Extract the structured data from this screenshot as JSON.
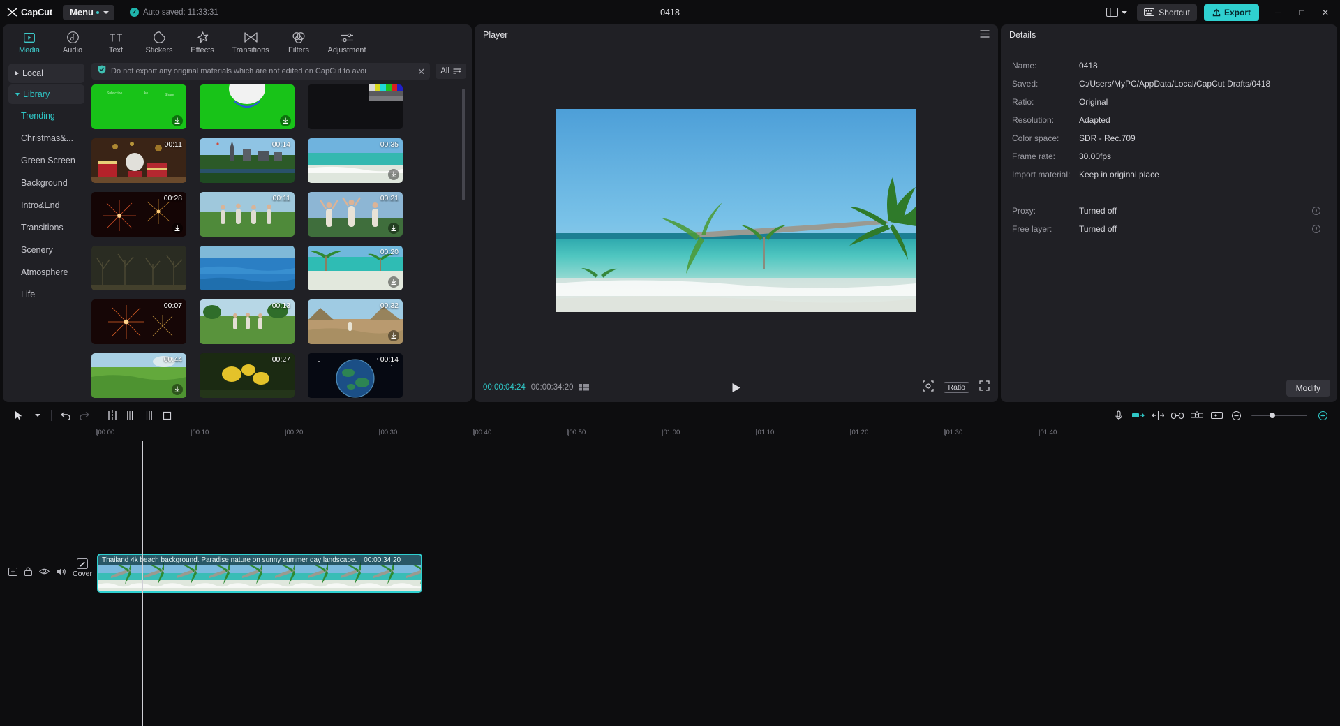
{
  "titlebar": {
    "brand": "CapCut",
    "menu_label": "Menu",
    "autosave_text": "Auto saved: 11:33:31",
    "project_title": "0418",
    "shortcut_label": "Shortcut",
    "export_label": "Export",
    "minimize_glyph": "─",
    "maximize_glyph": "□",
    "close_glyph": "✕"
  },
  "tabs": [
    {
      "label": "Media",
      "icon": "media-icon",
      "active": true
    },
    {
      "label": "Audio",
      "icon": "audio-icon",
      "active": false
    },
    {
      "label": "Text",
      "icon": "text-icon",
      "active": false
    },
    {
      "label": "Stickers",
      "icon": "stickers-icon",
      "active": false
    },
    {
      "label": "Effects",
      "icon": "effects-icon",
      "active": false
    },
    {
      "label": "Transitions",
      "icon": "transitions-icon",
      "active": false
    },
    {
      "label": "Filters",
      "icon": "filters-icon",
      "active": false
    },
    {
      "label": "Adjustment",
      "icon": "adjustment-icon",
      "active": false
    }
  ],
  "sidebar": {
    "groups": [
      {
        "label": "Local",
        "expanded": false
      },
      {
        "label": "Library",
        "expanded": true
      }
    ],
    "items": [
      {
        "label": "Trending",
        "active": true
      },
      {
        "label": "Christmas&...",
        "active": false
      },
      {
        "label": "Green Screen",
        "active": false
      },
      {
        "label": "Background",
        "active": false
      },
      {
        "label": "Intro&End",
        "active": false
      },
      {
        "label": "Transitions",
        "active": false
      },
      {
        "label": "Scenery",
        "active": false
      },
      {
        "label": "Atmosphere",
        "active": false
      },
      {
        "label": "Life",
        "active": false
      }
    ]
  },
  "notice": {
    "text": "Do not export any original materials which are not edited on CapCut to avoi",
    "close_glyph": "✕"
  },
  "filter": {
    "label": "All"
  },
  "media_grid": [
    {
      "duration": "",
      "kind": "greenscreen-a"
    },
    {
      "duration": "",
      "kind": "greenscreen-b"
    },
    {
      "duration": "",
      "kind": "colorbars"
    },
    {
      "duration": "00:11",
      "kind": "christmas"
    },
    {
      "duration": "00:14",
      "kind": "cityscape"
    },
    {
      "duration": "00:35",
      "kind": "beach"
    },
    {
      "duration": "00:28",
      "kind": "fireworks"
    },
    {
      "duration": "00:11",
      "kind": "friends-field"
    },
    {
      "duration": "00:21",
      "kind": "friends-sunset"
    },
    {
      "duration": "",
      "kind": "trees"
    },
    {
      "duration": "",
      "kind": "bluewater"
    },
    {
      "duration": "00:20",
      "kind": "tropic"
    },
    {
      "duration": "00:07",
      "kind": "fireworks2"
    },
    {
      "duration": "00:13",
      "kind": "park"
    },
    {
      "duration": "00:32",
      "kind": "canyon"
    },
    {
      "duration": "00:44",
      "kind": "greenfield"
    },
    {
      "duration": "00:27",
      "kind": "yellow"
    },
    {
      "duration": "00:14",
      "kind": "earth"
    }
  ],
  "player": {
    "title": "Player",
    "current_time": "00:00:04:24",
    "total_time": "00:00:34:20",
    "ratio_label": "Ratio"
  },
  "details": {
    "title": "Details",
    "rows": [
      {
        "key": "Name:",
        "value": "0418"
      },
      {
        "key": "Saved:",
        "value": "C:/Users/MyPC/AppData/Local/CapCut Drafts/0418"
      },
      {
        "key": "Ratio:",
        "value": "Original"
      },
      {
        "key": "Resolution:",
        "value": "Adapted"
      },
      {
        "key": "Color space:",
        "value": "SDR - Rec.709"
      },
      {
        "key": "Frame rate:",
        "value": "30.00fps"
      },
      {
        "key": "Import material:",
        "value": "Keep in original place"
      }
    ],
    "rows2": [
      {
        "key": "Proxy:",
        "value": "Turned off",
        "info": true
      },
      {
        "key": "Free layer:",
        "value": "Turned off",
        "info": true
      }
    ],
    "modify_label": "Modify"
  },
  "timeline": {
    "ruler_ticks": [
      "00:00",
      "00:10",
      "00:20",
      "00:30",
      "00:40",
      "00:50",
      "01:00",
      "01:10",
      "01:20",
      "01:30",
      "01:40"
    ],
    "cover_label": "Cover",
    "clip": {
      "title": "Thailand 4k beach background. Paradise nature on sunny summer day landscape.",
      "duration": "00:00:34:20"
    }
  }
}
